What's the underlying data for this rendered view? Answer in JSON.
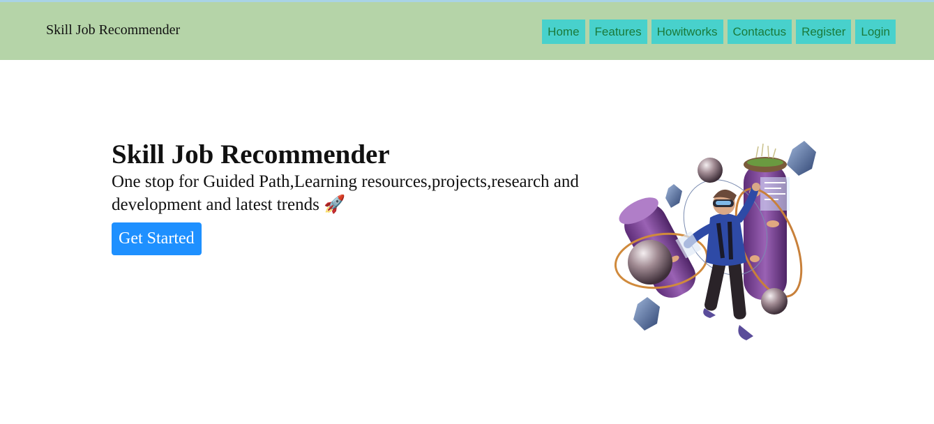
{
  "navbar": {
    "brand": "Skill Job Recommender",
    "links": [
      "Home",
      "Features",
      "Howitworks",
      "Contactus",
      "Register",
      "Login"
    ]
  },
  "hero": {
    "title": "Skill Job Recommender",
    "subtitle": "One stop for Guided Path,Learning resources,projects,research and development and latest trends",
    "emoji": "🚀",
    "cta_label": "Get Started"
  },
  "colors": {
    "navbar_bg": "#b5d4a8",
    "nav_link_bg": "#48d1cc",
    "nav_link_text": "#1a7a3a",
    "cta_bg": "#1e90ff"
  },
  "icons": {
    "emoji": "rocket-icon",
    "illustration": "vr-person-illustration"
  }
}
